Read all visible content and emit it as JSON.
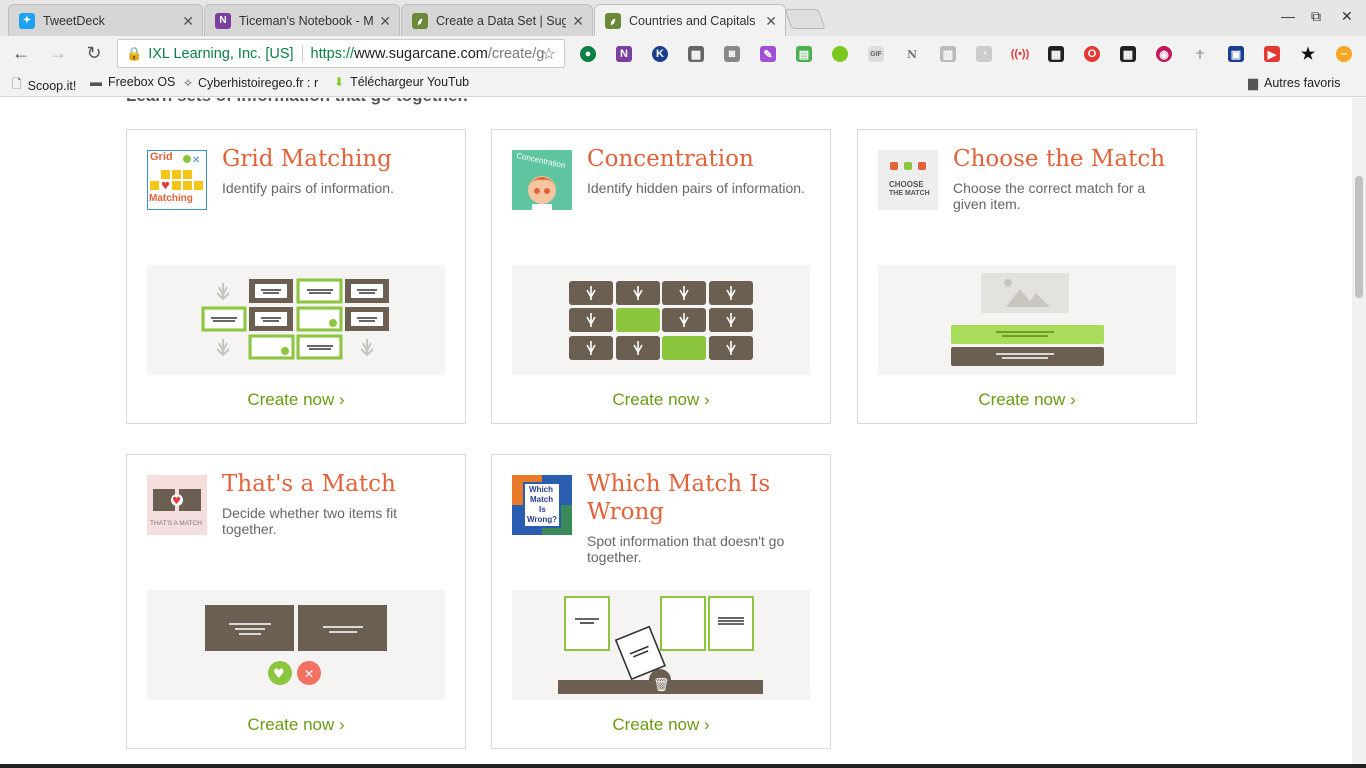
{
  "tabs": [
    {
      "title": "TweetDeck",
      "icon": "tweetdeck-icon",
      "color": "#1da1f2"
    },
    {
      "title": "Ticeman's Notebook - M",
      "icon": "onenote-icon",
      "color": "#7b3fa0"
    },
    {
      "title": "Create a Data Set | Sug",
      "icon": "sugarcane-icon",
      "color": "#6a8a3a"
    },
    {
      "title": "Countries and Capitals",
      "icon": "sugarcane-icon",
      "color": "#6a8a3a"
    }
  ],
  "toolbar": {
    "secure_label": "IXL Learning, Inc. [US]",
    "url_scheme": "https://",
    "url_host": "www.sugarcane.com",
    "url_path": "/create/g"
  },
  "bookmarks": [
    {
      "label": "Scoop.it!",
      "icon": "page-icon"
    },
    {
      "label": "Freebox OS",
      "icon": "freebox-icon"
    },
    {
      "label": "Cyberhistoiregeo.fr : r",
      "icon": "fox-icon"
    },
    {
      "label": "Téléchargeur YouTub",
      "icon": "download-icon"
    }
  ],
  "other_bookmarks": "Autres favoris",
  "page": {
    "cut_heading": "Learn sets of information that go together.",
    "cards": [
      {
        "title": "Grid Matching",
        "desc": "Identify pairs of information.",
        "cta": "Create now ›"
      },
      {
        "title": "Concentration",
        "desc": "Identify hidden pairs of information.",
        "cta": "Create now ›"
      },
      {
        "title": "Choose the Match",
        "desc": "Choose the correct match for a given item.",
        "cta": "Create now ›"
      },
      {
        "title": "That's a Match",
        "desc": "Decide whether two items fit together.",
        "cta": "Create now ›"
      },
      {
        "title": "Which Match Is Wrong",
        "desc": "Spot information that doesn't go together.",
        "cta": "Create now ›"
      }
    ],
    "thumb_text": {
      "grid": [
        "Grid",
        "Matching"
      ],
      "concentration": "Concentration",
      "choose": [
        "CHOOSE",
        "THE MATCH"
      ],
      "thats": "THAT'S A MATCH",
      "wrong": [
        "Which",
        "Match",
        "Is",
        "Wrong?"
      ]
    }
  },
  "colors": {
    "accent_title": "#e2623a",
    "cta_green": "#6a9b12",
    "tile_brown": "#6b5f52",
    "tile_green": "#8cc63f"
  }
}
